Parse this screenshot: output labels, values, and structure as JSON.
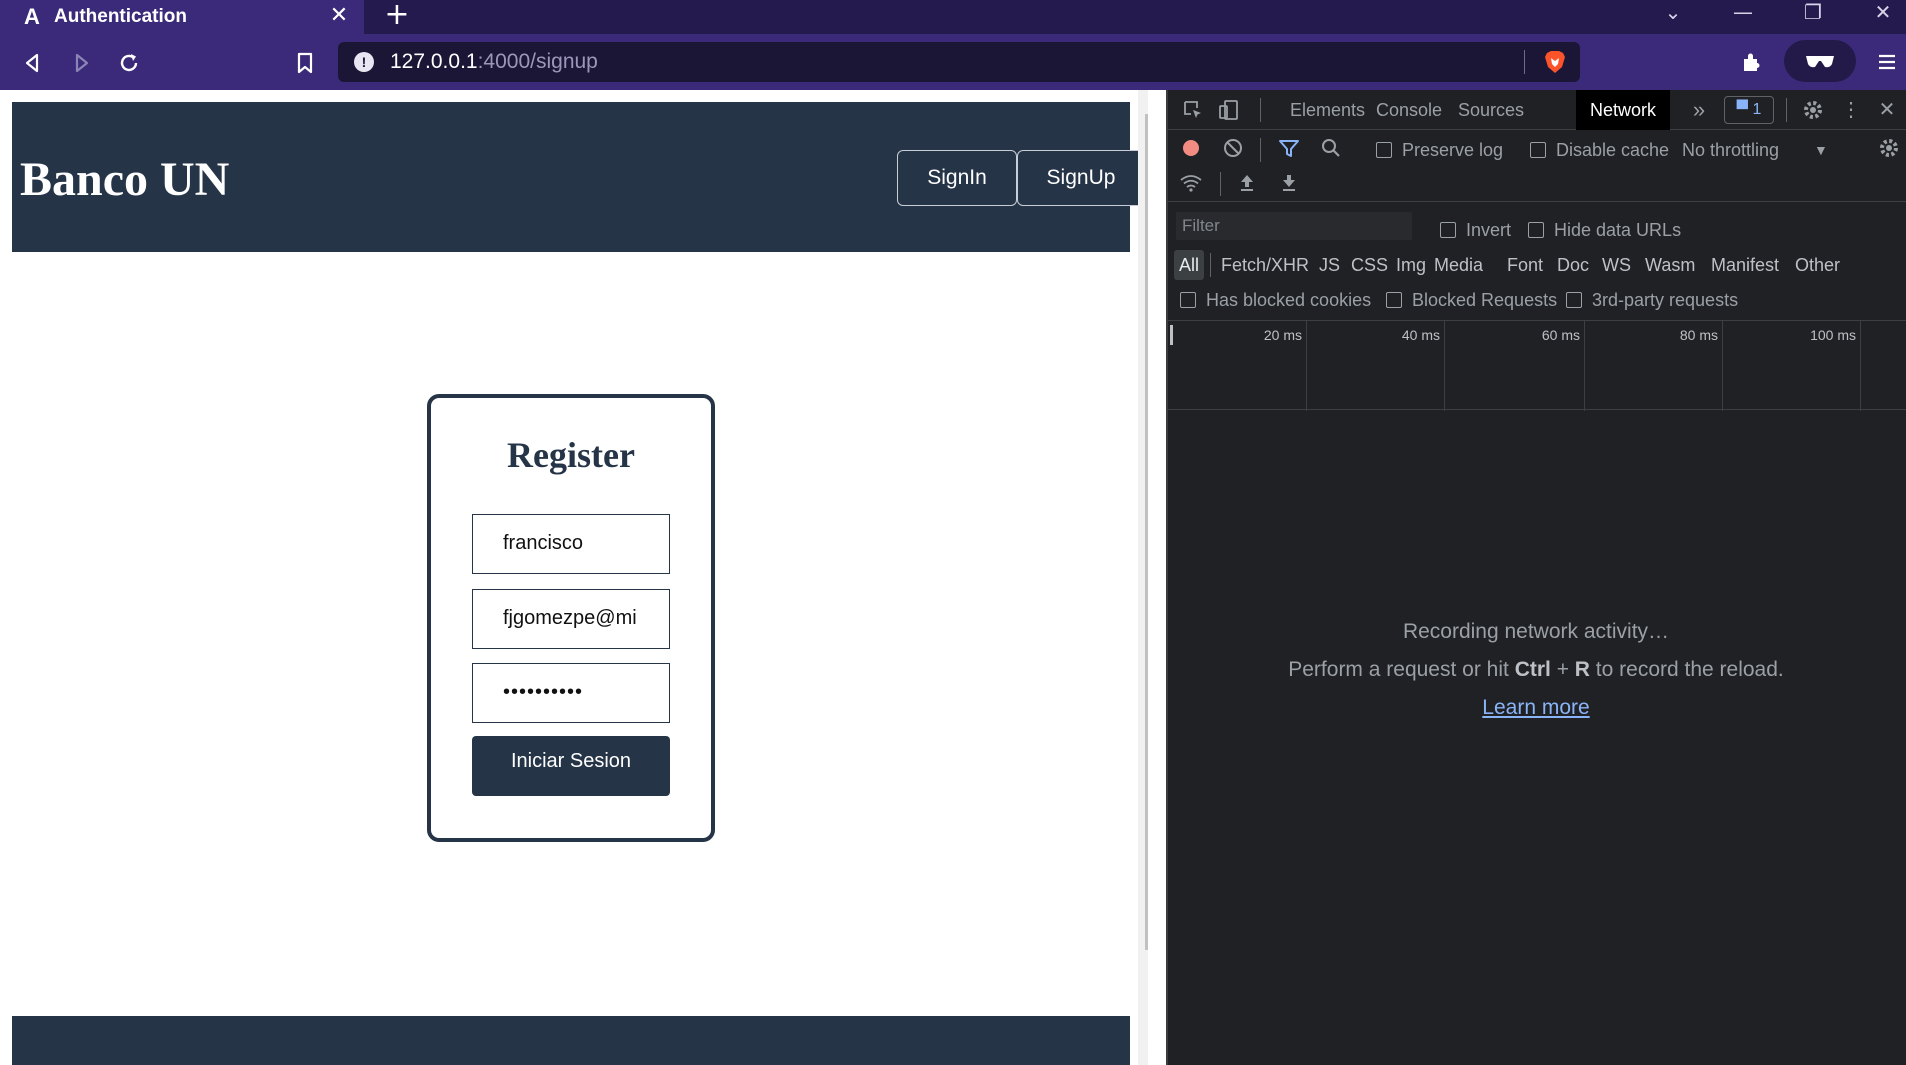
{
  "browser": {
    "tab": {
      "favicon": "A",
      "title": "Authentication",
      "close": "✕"
    },
    "new_tab": "+",
    "window_controls": {
      "minimize": "—",
      "restore": "❐",
      "close": "✕",
      "dropdown": "⌄"
    },
    "url": {
      "host": "127.0.0.1",
      "path": ":4000/signup"
    },
    "icons": [
      "back-icon",
      "forward-icon",
      "reload-icon",
      "bookmark-icon",
      "site-info-icon",
      "brave-shields-icon",
      "extensions-icon",
      "profile-icon",
      "menu-icon"
    ]
  },
  "page": {
    "brand": "Banco UN",
    "nav": {
      "signin": "SignIn",
      "signup": "SignUp"
    },
    "register": {
      "title": "Register",
      "username": "francisco",
      "email": "fjgomezpe@mi",
      "password_mask": "••••••••••",
      "submit": "Iniciar Sesion"
    },
    "colors": {
      "primary": "#253447"
    }
  },
  "devtools": {
    "tabs": [
      "Elements",
      "Console",
      "Sources",
      "Network"
    ],
    "active_tab": "Network",
    "more_tabs": "»",
    "issues_count": "1",
    "toolbar": {
      "preserve_log": "Preserve log",
      "disable_cache": "Disable cache",
      "throttling": "No throttling"
    },
    "filter": {
      "placeholder": "Filter",
      "invert": "Invert",
      "hide_data_urls": "Hide data URLs"
    },
    "types": [
      "All",
      "Fetch/XHR",
      "JS",
      "CSS",
      "Img",
      "Media",
      "Font",
      "Doc",
      "WS",
      "Wasm",
      "Manifest",
      "Other"
    ],
    "options": {
      "blocked_cookies": "Has blocked cookies",
      "blocked_requests": "Blocked Requests",
      "third_party": "3rd-party requests"
    },
    "timeline": [
      "20 ms",
      "40 ms",
      "60 ms",
      "80 ms",
      "100 ms"
    ],
    "empty": {
      "title": "Recording network activity…",
      "hint_before": "Perform a request or hit ",
      "shortcut_ctrl": "Ctrl",
      "shortcut_plus": " + ",
      "shortcut_key": "R",
      "hint_after": " to record the reload.",
      "learn_more": "Learn more"
    },
    "colors": {
      "record": "#f28b82",
      "link": "#8ab4f8",
      "filter_active": "#8ab4f8"
    }
  }
}
